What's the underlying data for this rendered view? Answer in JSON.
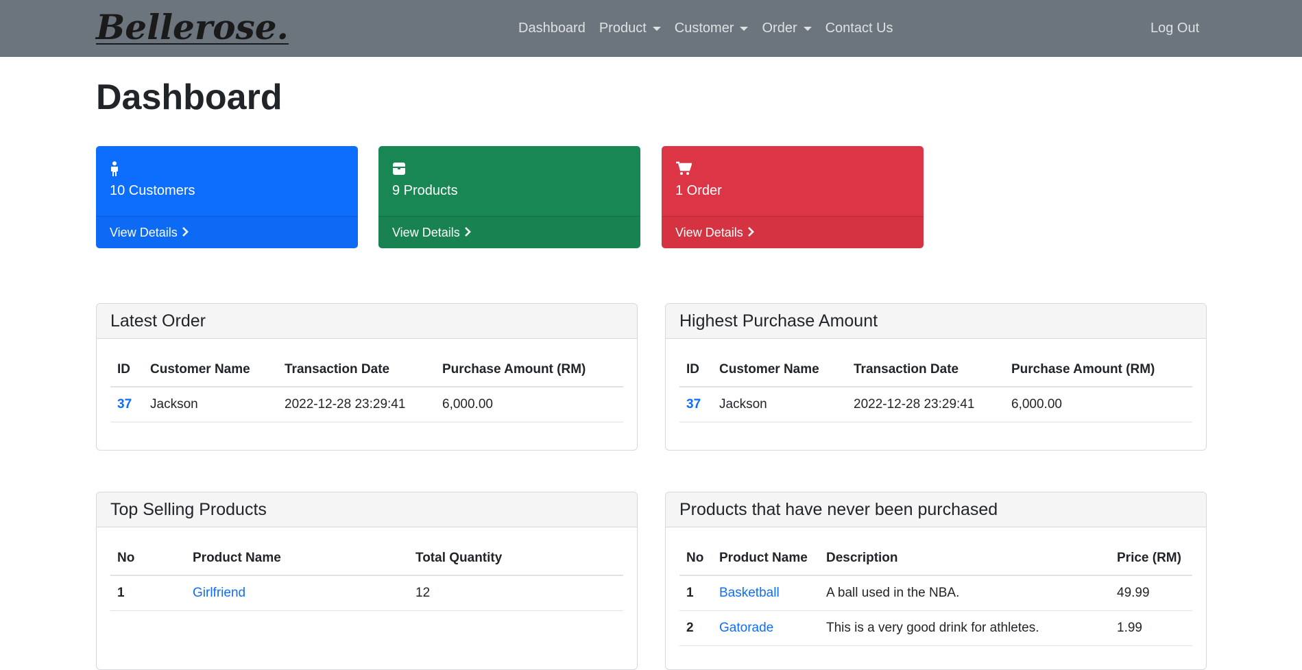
{
  "nav": {
    "brand": "Bellerose.",
    "items": [
      {
        "label": "Dashboard"
      },
      {
        "label": "Product"
      },
      {
        "label": "Customer"
      },
      {
        "label": "Order"
      },
      {
        "label": "Contact Us"
      }
    ],
    "logout": "Log Out"
  },
  "page": {
    "title": "Dashboard"
  },
  "stats": [
    {
      "text": "10 Customers",
      "link": "View Details",
      "icon": "person-icon",
      "color": "#0d6efd"
    },
    {
      "text": "9 Products",
      "link": "View Details",
      "icon": "box-icon",
      "color": "#198754"
    },
    {
      "text": "1 Order",
      "link": "View Details",
      "icon": "cart-icon",
      "color": "#dc3545"
    }
  ],
  "latest_order": {
    "title": "Latest Order",
    "headers": [
      "ID",
      "Customer Name",
      "Transaction Date",
      "Purchase Amount (RM)"
    ],
    "rows": [
      {
        "id": "37",
        "customer": "Jackson",
        "date": "2022-12-28 23:29:41",
        "amount": "6,000.00"
      }
    ]
  },
  "highest_purchase": {
    "title": "Highest Purchase Amount",
    "headers": [
      "ID",
      "Customer Name",
      "Transaction Date",
      "Purchase Amount (RM)"
    ],
    "rows": [
      {
        "id": "37",
        "customer": "Jackson",
        "date": "2022-12-28 23:29:41",
        "amount": "6,000.00"
      }
    ]
  },
  "top_selling": {
    "title": "Top Selling Products",
    "headers": [
      "No",
      "Product Name",
      "Total Quantity"
    ],
    "rows": [
      {
        "no": "1",
        "name": "Girlfriend",
        "qty": "12"
      }
    ]
  },
  "never_purchased": {
    "title": "Products that have never been purchased",
    "headers": [
      "No",
      "Product Name",
      "Description",
      "Price (RM)"
    ],
    "rows": [
      {
        "no": "1",
        "name": "Basketball",
        "desc": "A ball used in the NBA.",
        "price": "49.99"
      },
      {
        "no": "2",
        "name": "Gatorade",
        "desc": "This is a very good drink for athletes.",
        "price": "1.99"
      }
    ]
  }
}
